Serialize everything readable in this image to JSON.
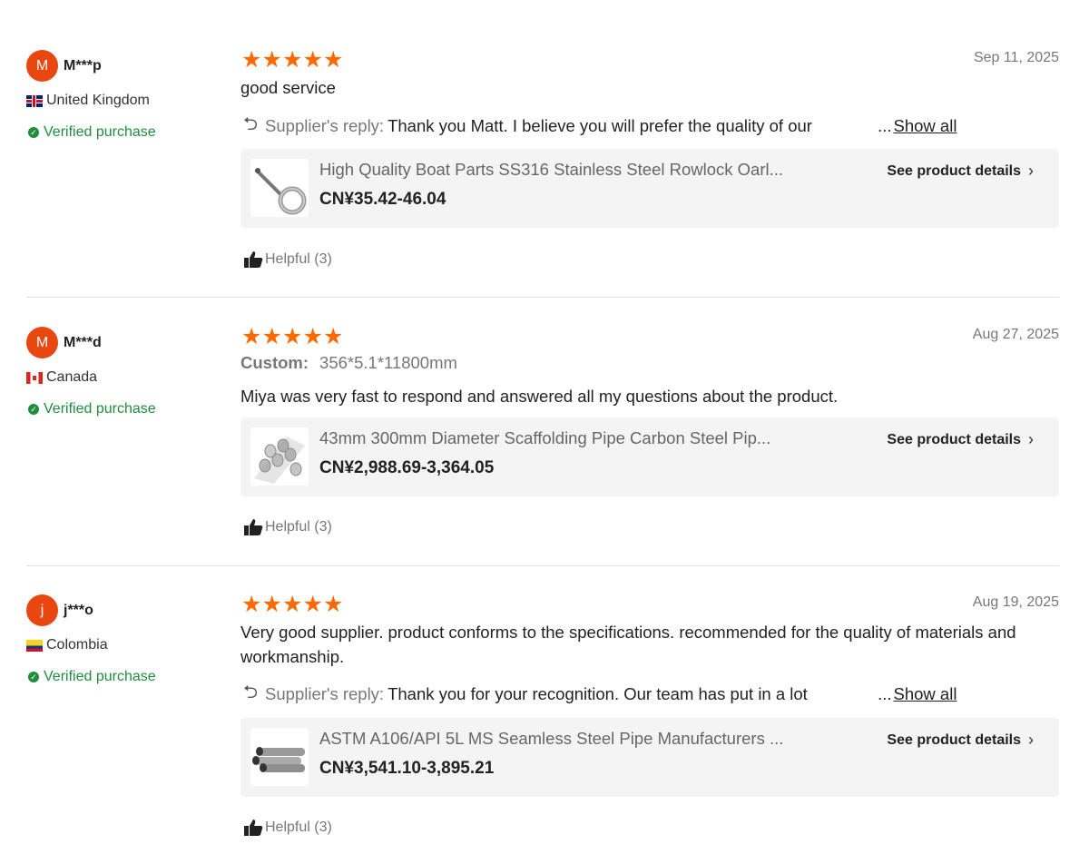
{
  "reviews": [
    {
      "avatar_letter": "M",
      "username": "M***p",
      "country": "United Kingdom",
      "verified": "Verified purchase",
      "rating": 5,
      "date": "Sep 11, 2025",
      "text": "good service",
      "reply_label": "Supplier's reply:",
      "reply_text": "Thank you Matt. I believe you will prefer the quality of our",
      "show_all": "Show all",
      "product_name": "High Quality Boat Parts SS316 Stainless Steel Rowlock Oarl...",
      "product_price": "CN¥35.42-46.04",
      "details_label": "See product details",
      "helpful": "Helpful (3)"
    },
    {
      "avatar_letter": "M",
      "username": "M***d",
      "country": "Canada",
      "verified": "Verified purchase",
      "rating": 5,
      "date": "Aug 27, 2025",
      "custom_label": "Custom:",
      "custom_value": "356*5.1*11800mm",
      "text": "Miya was very fast to respond and answered all my questions about the product.",
      "product_name": "43mm 300mm Diameter Scaffolding Pipe Carbon Steel Pip...",
      "product_price": "CN¥2,988.69-3,364.05",
      "details_label": "See product details",
      "helpful": "Helpful (3)"
    },
    {
      "avatar_letter": "j",
      "username": "j***o",
      "country": "Colombia",
      "verified": "Verified purchase",
      "rating": 5,
      "date": "Aug 19, 2025",
      "text": "Very good supplier. product conforms to the specifications. recommended for the quality of materials and workmanship.",
      "reply_label": "Supplier's reply:",
      "reply_text": "Thank you for your recognition. Our team has put in a lot",
      "show_all": "Show all",
      "product_name": "ASTM A106/API 5L MS Seamless Steel Pipe Manufacturers ...",
      "product_price": "CN¥3,541.10-3,895.21",
      "details_label": "See product details",
      "helpful": "Helpful (3)"
    }
  ],
  "colors": {
    "accent": "#ff6a00",
    "avatar": "#e8470f",
    "verified": "#1e8e3e",
    "card_bg": "#f4f4f4"
  },
  "icons": [
    "star-icon",
    "reply-arrow-icon",
    "thumbs-up-icon",
    "chevron-right-icon",
    "check-circle-icon",
    "flag-icon"
  ]
}
